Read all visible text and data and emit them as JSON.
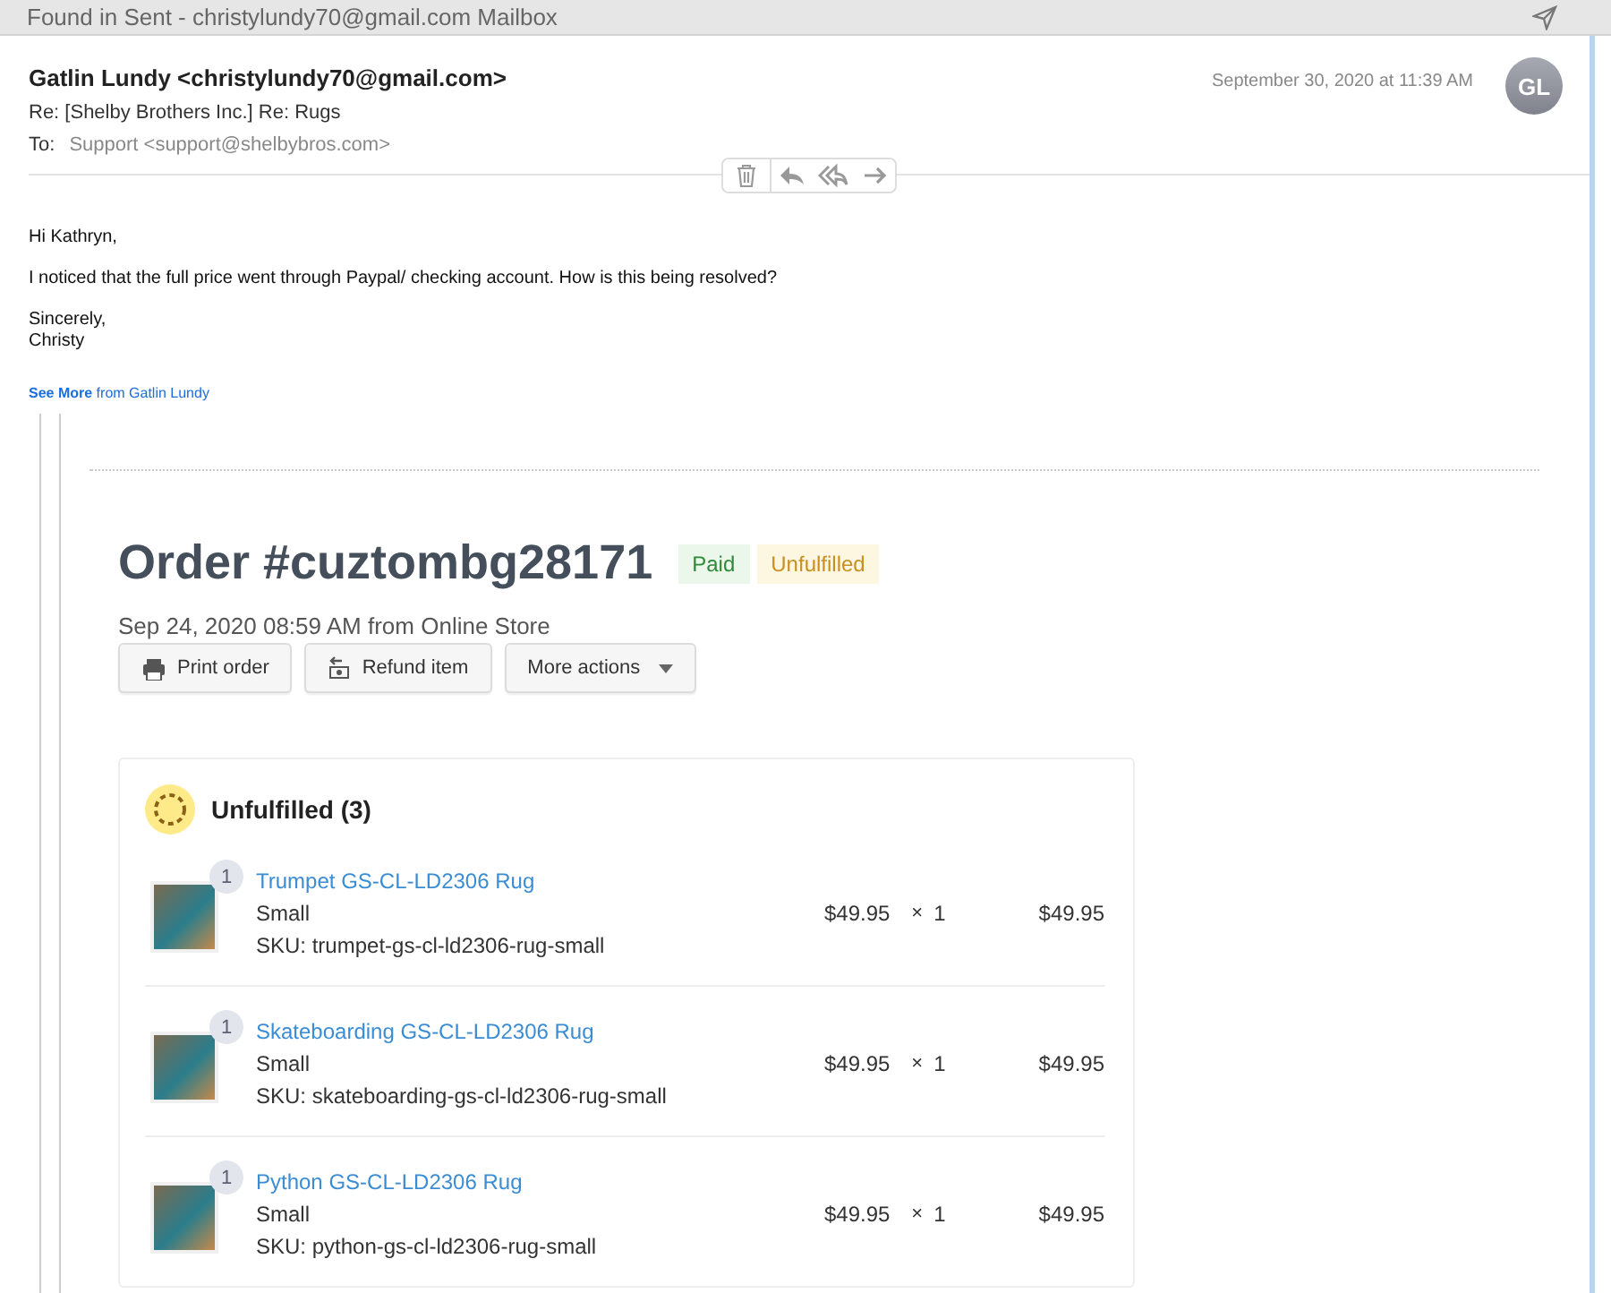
{
  "window": {
    "title": "Found in Sent - christylundy70@gmail.com Mailbox"
  },
  "message": {
    "from": "Gatlin Lundy <christylundy70@gmail.com>",
    "subject": "Re: [Shelby Brothers Inc.] Re: Rugs",
    "to_label": "To:",
    "to": "Support <support@shelbybros.com>",
    "date": "September 30, 2020 at 11:39 AM",
    "avatar": "GL"
  },
  "body": {
    "greeting": "Hi Kathryn,",
    "paragraph": "I noticed that the full price went through Paypal/ checking account. How is this being resolved?",
    "closing": "Sincerely,",
    "signature": "Christy",
    "see_more": "**See More** from Gatlin Lundy"
  },
  "order": {
    "title": "Order #cuztombg28171",
    "badges": [
      {
        "label": "Paid",
        "kind": "success"
      },
      {
        "label": "Unfulfilled",
        "kind": "warning"
      }
    ],
    "meta": "Sep 24, 2020 08:59 AM from Online Store",
    "actions": [
      {
        "label": "Print order",
        "kind": "print"
      },
      {
        "label": "Refund item",
        "kind": "refund"
      },
      {
        "label": "More actions",
        "kind": "menu"
      }
    ],
    "fulfillment": {
      "title": "Unfulfilled (3)",
      "items": [
        {
          "count": "1",
          "name": "Trumpet GS-CL-LD2306 Rug",
          "variant": "Small",
          "sku": "SKU: trumpet-gs-cl-ld2306-rug-small",
          "price": "$49.95",
          "times": "×",
          "quantity": "1",
          "total": "$49.95"
        },
        {
          "count": "1",
          "name": "Skateboarding GS-CL-LD2306 Rug",
          "variant": "Small",
          "sku": "SKU: skateboarding-gs-cl-ld2306-rug-small",
          "price": "$49.95",
          "times": "×",
          "quantity": "1",
          "total": "$49.95"
        },
        {
          "count": "1",
          "name": "Python GS-CL-LD2306 Rug",
          "variant": "Small",
          "sku": "SKU: python-gs-cl-ld2306-rug-small",
          "price": "$49.95",
          "times": "×",
          "quantity": "1",
          "total": "$49.95"
        }
      ]
    }
  }
}
